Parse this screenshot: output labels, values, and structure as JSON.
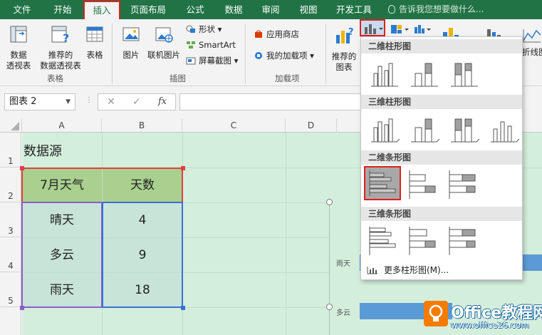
{
  "tabs": [
    {
      "label": "文件"
    },
    {
      "label": "开始"
    },
    {
      "label": "插入"
    },
    {
      "label": "页面布局"
    },
    {
      "label": "公式"
    },
    {
      "label": "数据"
    },
    {
      "label": "审阅"
    },
    {
      "label": "视图"
    },
    {
      "label": "开发工具"
    }
  ],
  "tellme": "告诉我您想要做什么...",
  "ribbon": {
    "pivot": "数据\n透视表",
    "recommended_pivot": "推荐的\n数据透视表",
    "table": "表格",
    "group_tables": "表格",
    "picture": "图片",
    "online_picture": "联机图片",
    "shapes": "形状",
    "smartart": "SmartArt",
    "screenshot": "屏幕截图",
    "group_illustrations": "插图",
    "store": "应用商店",
    "my_addins": "我的加载项",
    "group_addins": "加载项",
    "recommended_charts": "推荐的\n图表",
    "line_chart": "折线图"
  },
  "formula_bar": {
    "name_box": "图表 2",
    "fx": "fx"
  },
  "columns": [
    "A",
    "B",
    "C",
    "D"
  ],
  "rows": [
    "1",
    "2",
    "3",
    "4",
    "5"
  ],
  "sheet": {
    "title": "数据源",
    "header_a": "7月天气",
    "header_b": "天数",
    "data": [
      {
        "weather": "晴天",
        "days": "4"
      },
      {
        "weather": "多云",
        "days": "9"
      },
      {
        "weather": "雨天",
        "days": "18"
      }
    ]
  },
  "chart": {
    "labels": [
      "雨天",
      "多云"
    ]
  },
  "dropdown": {
    "sections": [
      "二维柱形图",
      "三维柱形图",
      "二维条形图",
      "三维条形图"
    ],
    "more": "更多柱形图(M)..."
  },
  "watermark": {
    "title": "Office教程网",
    "url": "www.office26.com"
  },
  "colors": {
    "excel_green": "#217346",
    "selection_red": "#e02020",
    "sheet_bg": "#d4eedc",
    "bar_blue": "#5b9bd5"
  }
}
